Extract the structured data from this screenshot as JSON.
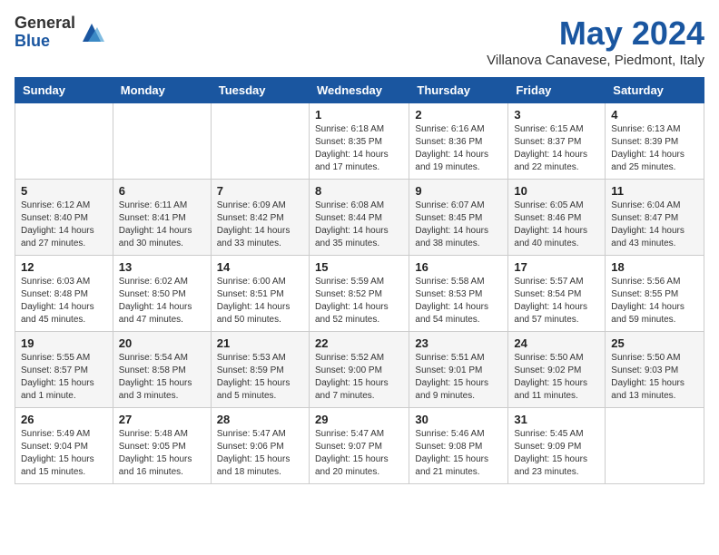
{
  "header": {
    "logo_general": "General",
    "logo_blue": "Blue",
    "month_title": "May 2024",
    "subtitle": "Villanova Canavese, Piedmont, Italy"
  },
  "weekdays": [
    "Sunday",
    "Monday",
    "Tuesday",
    "Wednesday",
    "Thursday",
    "Friday",
    "Saturday"
  ],
  "weeks": [
    [
      {
        "day": "",
        "info": ""
      },
      {
        "day": "",
        "info": ""
      },
      {
        "day": "",
        "info": ""
      },
      {
        "day": "1",
        "info": "Sunrise: 6:18 AM\nSunset: 8:35 PM\nDaylight: 14 hours and 17 minutes."
      },
      {
        "day": "2",
        "info": "Sunrise: 6:16 AM\nSunset: 8:36 PM\nDaylight: 14 hours and 19 minutes."
      },
      {
        "day": "3",
        "info": "Sunrise: 6:15 AM\nSunset: 8:37 PM\nDaylight: 14 hours and 22 minutes."
      },
      {
        "day": "4",
        "info": "Sunrise: 6:13 AM\nSunset: 8:39 PM\nDaylight: 14 hours and 25 minutes."
      }
    ],
    [
      {
        "day": "5",
        "info": "Sunrise: 6:12 AM\nSunset: 8:40 PM\nDaylight: 14 hours and 27 minutes."
      },
      {
        "day": "6",
        "info": "Sunrise: 6:11 AM\nSunset: 8:41 PM\nDaylight: 14 hours and 30 minutes."
      },
      {
        "day": "7",
        "info": "Sunrise: 6:09 AM\nSunset: 8:42 PM\nDaylight: 14 hours and 33 minutes."
      },
      {
        "day": "8",
        "info": "Sunrise: 6:08 AM\nSunset: 8:44 PM\nDaylight: 14 hours and 35 minutes."
      },
      {
        "day": "9",
        "info": "Sunrise: 6:07 AM\nSunset: 8:45 PM\nDaylight: 14 hours and 38 minutes."
      },
      {
        "day": "10",
        "info": "Sunrise: 6:05 AM\nSunset: 8:46 PM\nDaylight: 14 hours and 40 minutes."
      },
      {
        "day": "11",
        "info": "Sunrise: 6:04 AM\nSunset: 8:47 PM\nDaylight: 14 hours and 43 minutes."
      }
    ],
    [
      {
        "day": "12",
        "info": "Sunrise: 6:03 AM\nSunset: 8:48 PM\nDaylight: 14 hours and 45 minutes."
      },
      {
        "day": "13",
        "info": "Sunrise: 6:02 AM\nSunset: 8:50 PM\nDaylight: 14 hours and 47 minutes."
      },
      {
        "day": "14",
        "info": "Sunrise: 6:00 AM\nSunset: 8:51 PM\nDaylight: 14 hours and 50 minutes."
      },
      {
        "day": "15",
        "info": "Sunrise: 5:59 AM\nSunset: 8:52 PM\nDaylight: 14 hours and 52 minutes."
      },
      {
        "day": "16",
        "info": "Sunrise: 5:58 AM\nSunset: 8:53 PM\nDaylight: 14 hours and 54 minutes."
      },
      {
        "day": "17",
        "info": "Sunrise: 5:57 AM\nSunset: 8:54 PM\nDaylight: 14 hours and 57 minutes."
      },
      {
        "day": "18",
        "info": "Sunrise: 5:56 AM\nSunset: 8:55 PM\nDaylight: 14 hours and 59 minutes."
      }
    ],
    [
      {
        "day": "19",
        "info": "Sunrise: 5:55 AM\nSunset: 8:57 PM\nDaylight: 15 hours and 1 minute."
      },
      {
        "day": "20",
        "info": "Sunrise: 5:54 AM\nSunset: 8:58 PM\nDaylight: 15 hours and 3 minutes."
      },
      {
        "day": "21",
        "info": "Sunrise: 5:53 AM\nSunset: 8:59 PM\nDaylight: 15 hours and 5 minutes."
      },
      {
        "day": "22",
        "info": "Sunrise: 5:52 AM\nSunset: 9:00 PM\nDaylight: 15 hours and 7 minutes."
      },
      {
        "day": "23",
        "info": "Sunrise: 5:51 AM\nSunset: 9:01 PM\nDaylight: 15 hours and 9 minutes."
      },
      {
        "day": "24",
        "info": "Sunrise: 5:50 AM\nSunset: 9:02 PM\nDaylight: 15 hours and 11 minutes."
      },
      {
        "day": "25",
        "info": "Sunrise: 5:50 AM\nSunset: 9:03 PM\nDaylight: 15 hours and 13 minutes."
      }
    ],
    [
      {
        "day": "26",
        "info": "Sunrise: 5:49 AM\nSunset: 9:04 PM\nDaylight: 15 hours and 15 minutes."
      },
      {
        "day": "27",
        "info": "Sunrise: 5:48 AM\nSunset: 9:05 PM\nDaylight: 15 hours and 16 minutes."
      },
      {
        "day": "28",
        "info": "Sunrise: 5:47 AM\nSunset: 9:06 PM\nDaylight: 15 hours and 18 minutes."
      },
      {
        "day": "29",
        "info": "Sunrise: 5:47 AM\nSunset: 9:07 PM\nDaylight: 15 hours and 20 minutes."
      },
      {
        "day": "30",
        "info": "Sunrise: 5:46 AM\nSunset: 9:08 PM\nDaylight: 15 hours and 21 minutes."
      },
      {
        "day": "31",
        "info": "Sunrise: 5:45 AM\nSunset: 9:09 PM\nDaylight: 15 hours and 23 minutes."
      },
      {
        "day": "",
        "info": ""
      }
    ]
  ]
}
